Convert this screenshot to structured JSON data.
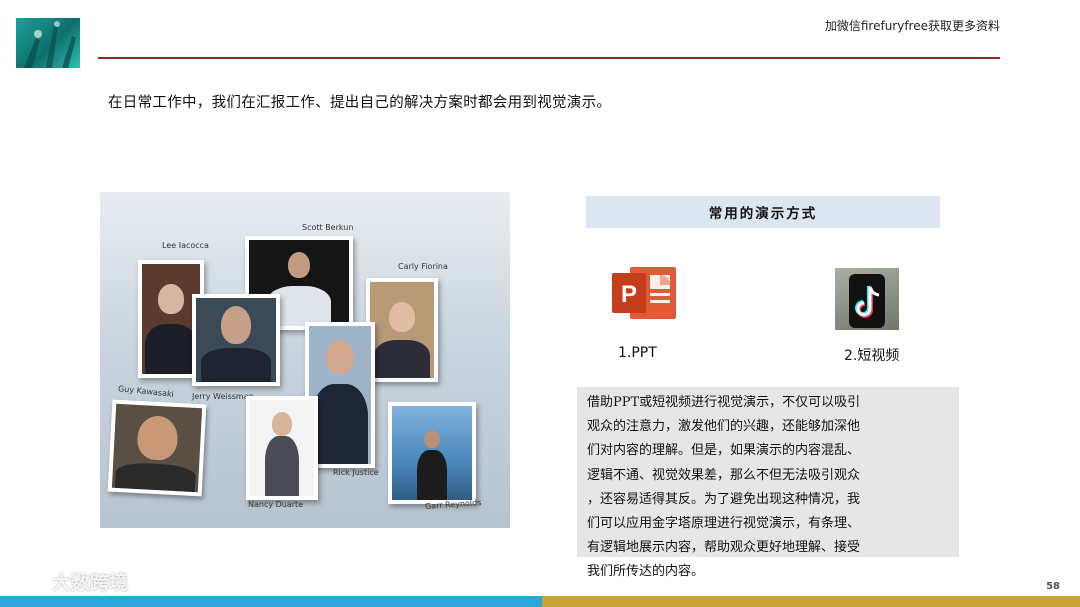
{
  "header": {
    "top_right_text": "加微信firefuryfree获取更多资料"
  },
  "intro_text": "在日常工作中，我们在汇报工作、提出自己的解决方案时都会用到视觉演示。",
  "photo_collage": {
    "names": [
      "Lee Iacocca",
      "Scott Berkun",
      "Carly Fiorina",
      "Guy Kawasaki",
      "Jerry Weissman",
      "Rick Justice",
      "Nancy Duarte",
      "Garr Reynolds"
    ]
  },
  "methods": {
    "header": "常用的演示方式",
    "items": [
      {
        "label": "1.PPT",
        "icon": "powerpoint-icon"
      },
      {
        "label": "2.短视频",
        "icon": "tiktok-icon"
      }
    ]
  },
  "description_lines": [
    "借助PPT或短视频进行视觉演示，不仅可以吸引",
    "观众的注意力，激发他们的兴趣，还能够加深他",
    "们对内容的理解。但是，如果演示的内容混乱、",
    "逻辑不通、视觉效果差，那么不但无法吸引观众",
    "，还容易适得其反。为了避免出现这种情况，我",
    "们可以应用金字塔原理进行视觉演示，有条理、",
    "有逻辑地展示内容，帮助观众更好地理解、接受",
    "我们所传达的内容。"
  ],
  "footer": {
    "page_number": "58",
    "watermark": "大数跨境"
  },
  "colors": {
    "header_rule": "#8b2e2a",
    "bar_left": "#29a8d8",
    "bar_right": "#c6a432",
    "ppt_orange": "#d04423"
  }
}
